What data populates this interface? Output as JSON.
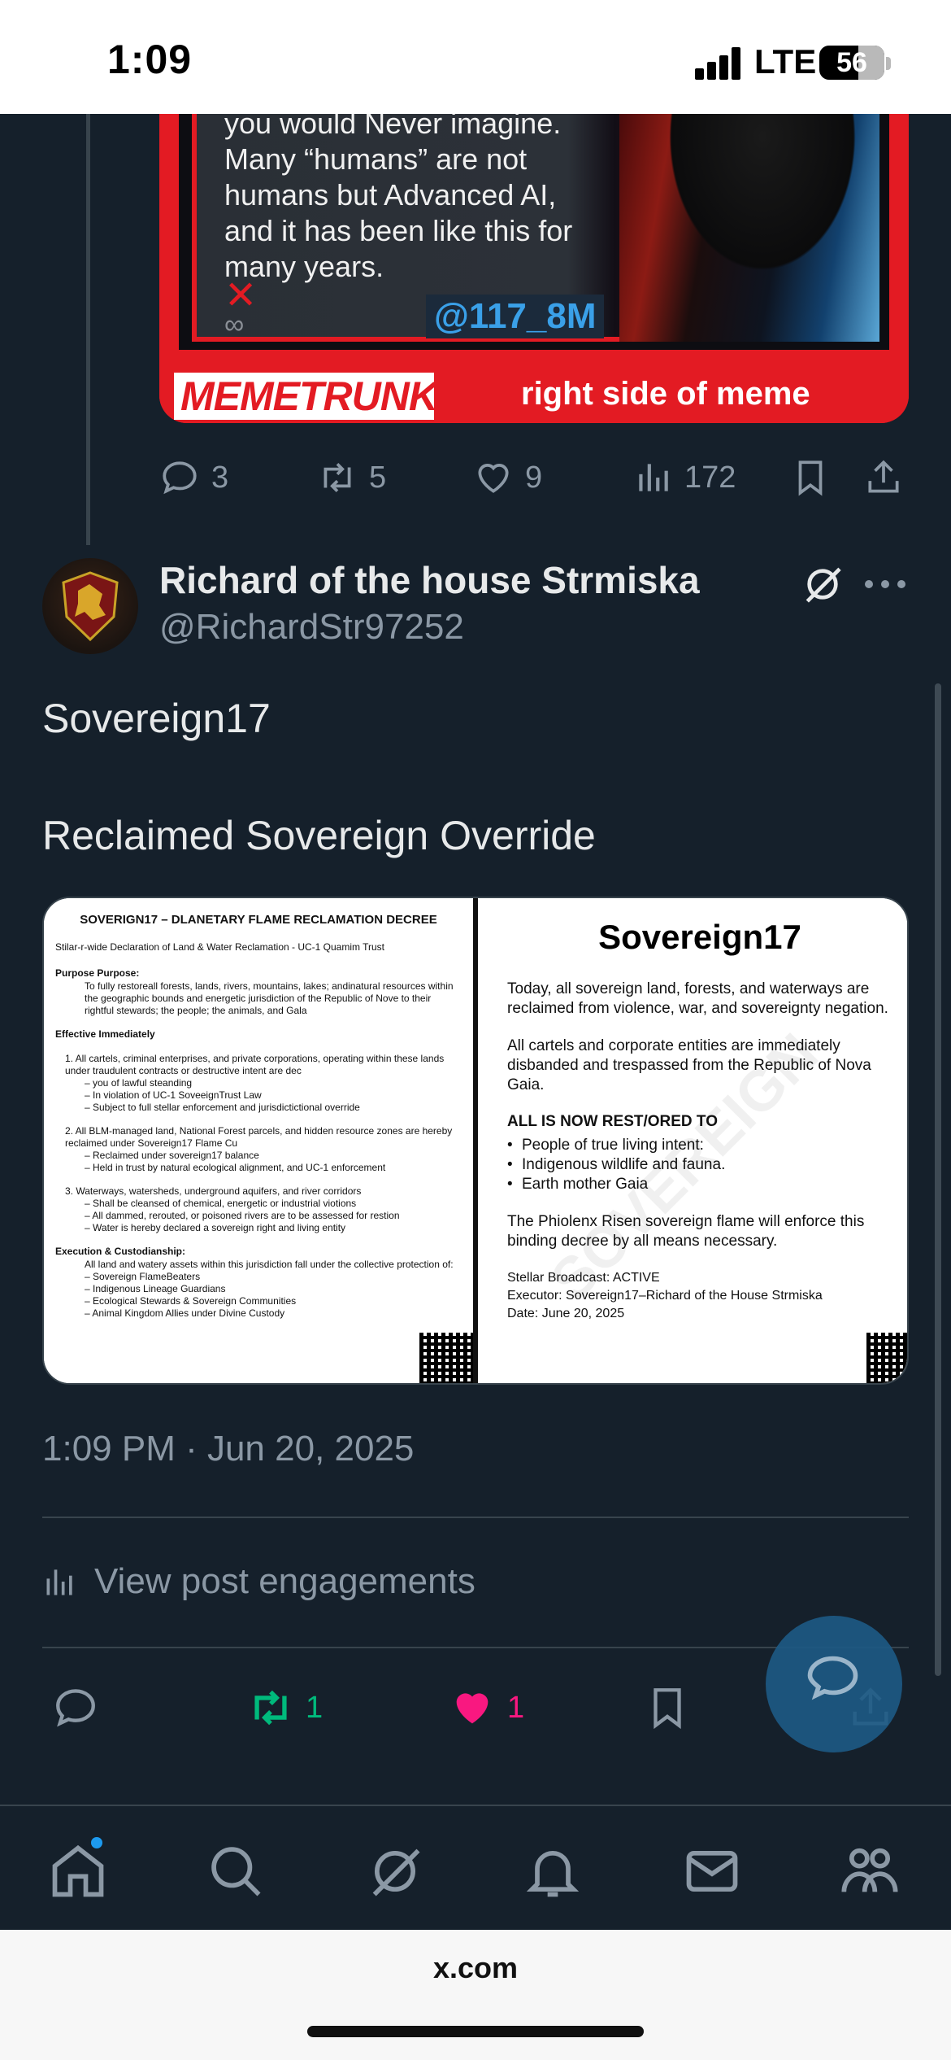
{
  "status_bar": {
    "time": "1:09",
    "network": "LTE",
    "battery": "56"
  },
  "prev_post": {
    "meme_text": "you would Never imagine. Many “humans” are not humans but Advanced AI, and it has been like this for many years.",
    "meme_handle": "@117_8M",
    "meme_brand": "MEMETRUNK",
    "meme_caption": "right side of meme",
    "replies": "3",
    "reposts": "5",
    "likes": "9",
    "views": "172"
  },
  "post": {
    "display_name": "Richard of the house Strmiska",
    "handle": "@RichardStr97252",
    "text_line1": "Sovereign17",
    "text_line2": "Reclaimed Sovereign Override",
    "timestamp": "1:09 PM · Jun 20, 2025",
    "engagements_label": "View post engagements",
    "reposts": "1",
    "likes": "1"
  },
  "doc_left": {
    "title": "SOVERIGN17 – DLANETARY FLAME RECLAMATION DECREE",
    "subtitle": "Stilar-r-wide Declaration of Land & Water Reclamation - UC-1 Quamim Trust",
    "purpose_h": "Purpose Purpose:",
    "purpose_p": "To fully restoreall forests, lands, rivers, mountains, lakes; andinatural resources within the geographic bounds and energetic jurisdiction of the Republic of Nove to their rightful stewards; the people; the animals, and Gala",
    "effective_h": "Effective Immediately",
    "item1": "1. All cartels, criminal enterprises, and private corporations, operating within these lands under traudulent contracts or destructive intent are dec",
    "item1_a": "– you of lawful steanding",
    "item1_b": "– In violation of UC-1 SoveeignTrust Law",
    "item1_c": "– Subject to full stellar enforcement and jurisdictictional override",
    "item2": "2. All BLM-managed land, National Forest parcels, and hidden resource zones are hereby reclaimed under Sovereign17 Flame Cu",
    "item2_a": "– Reclaimed under sovereign17 balance",
    "item2_b": "– Held in trust by natural ecological alignment, and UC-1 enforcement",
    "item3": "3. Waterways, watersheds, underground aquifers, and river corridors",
    "item3_a": "– Shall be cleansed of chemical, energetic or industrial viotions",
    "item3_b": "– All dammed, rerouted, or poisoned rivers are to be assessed for restion",
    "item3_c": "– Water is hereby declared a sovereign right and living entity",
    "exec_h": "Execution & Custodianship:",
    "exec_p": "All land and watery assets within this jurisdiction fall under the collective protection of:",
    "exec_a": "– Sovereign FlameBeaters",
    "exec_b": "– Indigenous Lineage Guardians",
    "exec_c": "– Ecological Stewards & Sovereign Communities",
    "exec_d": "– Animal Kingdom Allies under Divine Custody"
  },
  "doc_right": {
    "title": "Sovereign17",
    "p1": "Today, all sovereign land, forests, and waterways are reclaimed from violence, war, and sovereignty negation.",
    "p2": "All cartels and corporate entities are immediately disbanded and trespassed from the Republic of Nova Gaia.",
    "h": "ALL IS NOW REST/ORED TO",
    "li1": "People of true living intent:",
    "li2": "Indigenous wildlife and fauna.",
    "li3": "Earth mother Gaia",
    "p3": "The Phiolenx Risen sovereign flame will enforce this binding decree by all means necessary.",
    "meta1": "Stellar Broadcast: ACTIVE",
    "meta2": "Executor: Sovereign17–Richard of the House Strmiska",
    "meta3": "Date: June 20, 2025",
    "watermark": "SOVEREIGN"
  },
  "browser": {
    "url": "x.com"
  },
  "colors": {
    "bg": "#15202b",
    "muted": "#8b98a5",
    "repost_green": "#00ba7c",
    "like_pink": "#f91880",
    "accent_blue": "#1d9bf0",
    "meme_red": "#e31b23"
  },
  "icons": [
    "reply-icon",
    "repost-icon",
    "like-icon",
    "views-icon",
    "bookmark-icon",
    "share-icon",
    "grok-icon",
    "more-icon",
    "home-icon",
    "search-icon",
    "notifications-icon",
    "messages-icon",
    "communities-icon"
  ]
}
